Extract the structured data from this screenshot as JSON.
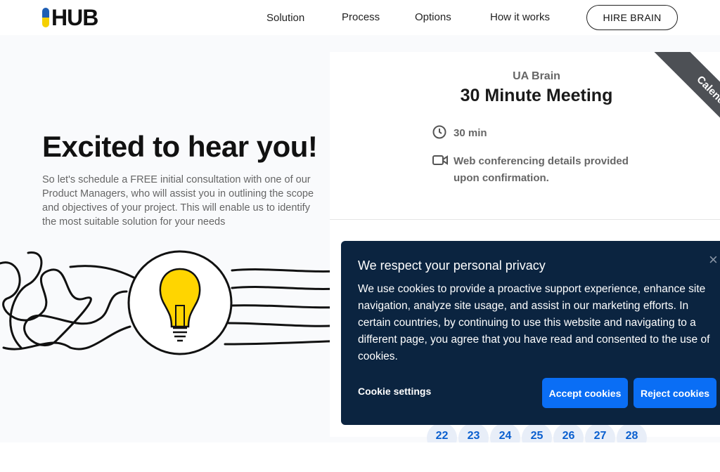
{
  "header": {
    "logo": "HUB",
    "nav": [
      "Solution",
      "Process",
      "Options",
      "How it works"
    ],
    "cta": "HIRE BRAIN"
  },
  "hero": {
    "title": "Excited to hear you!",
    "text": "So let's schedule a FREE initial consultation with one of our Product Managers, who will assist you in outlining the scope and objectives of your project. This will enable us to identify the most suitable solution for your needs"
  },
  "booking": {
    "organizer": "UA Brain",
    "title": "30 Minute Meeting",
    "duration": "30 min",
    "conferencing": "Web conferencing details provided upon confirmation.",
    "ribbon": "Calendly",
    "days": [
      "22",
      "23",
      "24",
      "25",
      "26",
      "27",
      "28"
    ]
  },
  "cookie": {
    "title": "We respect your personal privacy",
    "body": "We use cookies to provide a proactive support experience, enhance site navigation, analyze site usage, and assist in our marketing efforts. In certain countries, by continuing to use this website and navigating to a different page, you agree that you have read and consented to the use of cookies.",
    "settings": "Cookie settings",
    "accept": "Accept cookies",
    "reject": "Reject cookies",
    "close": "×",
    "colors": {
      "background": "#0b2440",
      "button": "#0a6ef5"
    }
  }
}
